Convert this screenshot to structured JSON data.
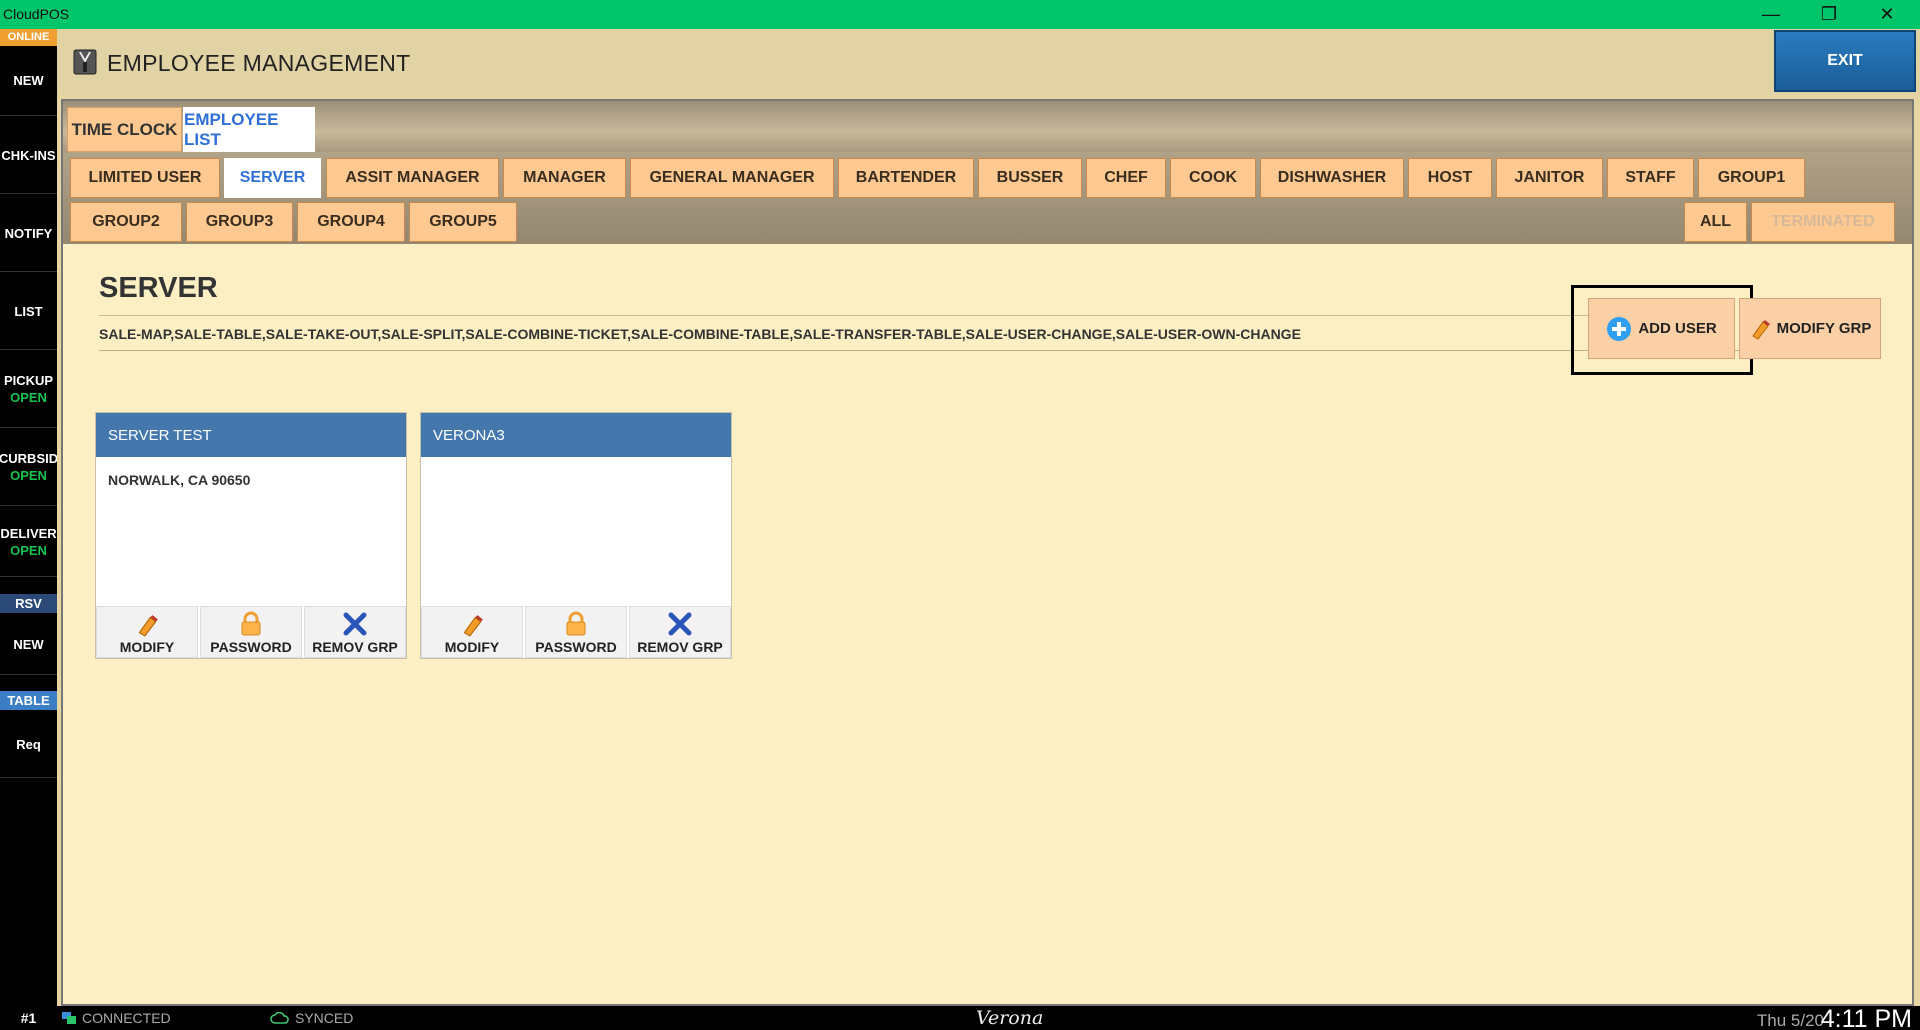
{
  "window": {
    "title": "CloudPOS"
  },
  "sidebar": {
    "status": "ONLINE",
    "items": [
      {
        "label": "NEW",
        "sub": ""
      },
      {
        "label": "CHK-INS",
        "sub": ""
      },
      {
        "label": "NOTIFY",
        "sub": ""
      },
      {
        "label": "LIST",
        "sub": ""
      },
      {
        "label": "PICKUP",
        "sub": "OPEN"
      },
      {
        "label": "CURBSID",
        "sub": "OPEN"
      },
      {
        "label": "DELIVER",
        "sub": "OPEN"
      }
    ],
    "rsv_label": "RSV",
    "rsv_new": "NEW",
    "table_label": "TABLE",
    "table_req": "Req"
  },
  "header": {
    "title": "EMPLOYEE MANAGEMENT",
    "exit_label": "EXIT"
  },
  "tabs": [
    "TIME CLOCK",
    "EMPLOYEE LIST"
  ],
  "active_tab": "EMPLOYEE LIST",
  "groups_row1": [
    "LIMITED USER",
    "SERVER",
    "ASSIT MANAGER",
    "MANAGER",
    "GENERAL MANAGER",
    "BARTENDER",
    "BUSSER",
    "CHEF",
    "COOK",
    "DISHWASHER",
    "HOST",
    "JANITOR",
    "STAFF",
    "GROUP1"
  ],
  "groups_row2": [
    "GROUP2",
    "GROUP3",
    "GROUP4",
    "GROUP5"
  ],
  "filter_all": "ALL",
  "filter_terminated": "TERMINATED",
  "active_group": "SERVER",
  "group_detail": {
    "name": "SERVER",
    "permissions": "SALE-MAP,SALE-TABLE,SALE-TAKE-OUT,SALE-SPLIT,SALE-COMBINE-TICKET,SALE-COMBINE-TABLE,SALE-TRANSFER-TABLE,SALE-USER-CHANGE,SALE-USER-OWN-CHANGE",
    "add_user_label": "ADD USER",
    "modify_grp_label": "MODIFY GRP"
  },
  "employees": [
    {
      "name": "SERVER TEST",
      "address": "NORWALK, CA 90650"
    },
    {
      "name": "VERONA3",
      "address": ""
    }
  ],
  "card_actions": {
    "modify": "MODIFY",
    "password": "PASSWORD",
    "remove": "REMOV GRP"
  },
  "status": {
    "terminal": "#1",
    "connection": "CONNECTED",
    "sync": "SYNCED",
    "brand": "Verona",
    "date": "Thu 5/20",
    "time": "4:11 PM"
  },
  "colors": {
    "titlebar": "#00c56a",
    "accent_blue": "#2f6fd6",
    "tab_orange": "#fdc991",
    "exit_blue": "#1a5d99"
  }
}
